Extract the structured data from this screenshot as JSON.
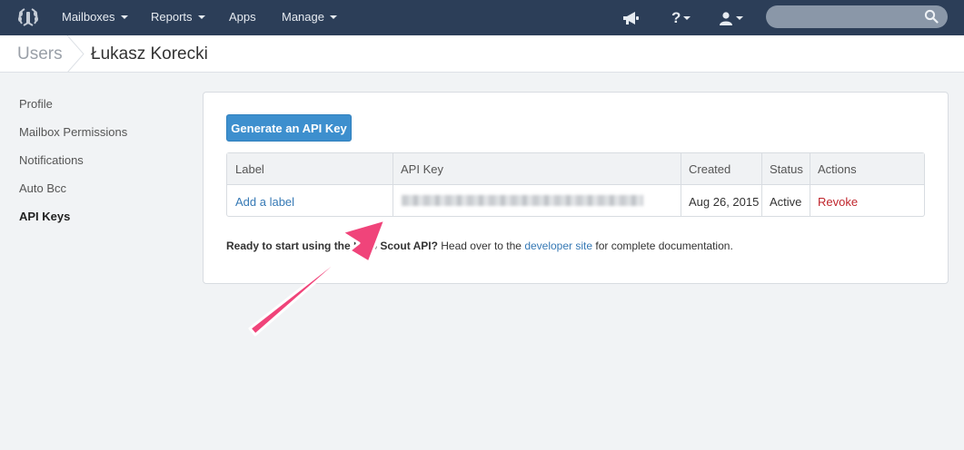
{
  "topnav": {
    "menus": [
      {
        "label": "Mailboxes",
        "has_caret": true
      },
      {
        "label": "Reports",
        "has_caret": true
      },
      {
        "label": "Apps",
        "has_caret": false
      },
      {
        "label": "Manage",
        "has_caret": true
      }
    ],
    "icons": [
      "laurel-logo-icon",
      "megaphone-icon",
      "help-icon",
      "user-icon",
      "search-icon"
    ],
    "help_glyph": "?",
    "search": {
      "placeholder": "",
      "value": ""
    }
  },
  "breadcrumb": {
    "parent": "Users",
    "current": "Łukasz Korecki"
  },
  "sidebar": {
    "items": [
      {
        "label": "Profile",
        "active": false
      },
      {
        "label": "Mailbox Permissions",
        "active": false
      },
      {
        "label": "Notifications",
        "active": false
      },
      {
        "label": "Auto Bcc",
        "active": false
      },
      {
        "label": "API Keys",
        "active": true
      }
    ]
  },
  "main": {
    "generate_button": "Generate an API Key",
    "table": {
      "headers": {
        "label": "Label",
        "api_key": "API Key",
        "created": "Created",
        "status": "Status",
        "actions": "Actions"
      },
      "rows": [
        {
          "label": "Add a label",
          "api_key": "(blurred)",
          "created": "Aug 26, 2015",
          "status": "Active",
          "action": "Revoke"
        }
      ]
    },
    "note": {
      "bold_part": "Ready to start using the Help Scout API?",
      "text_before_link": " Head over to the ",
      "link": "developer site",
      "text_after_link": " for complete documentation."
    }
  },
  "colors": {
    "topnav_bg": "#2c3e58",
    "primary_button": "#3d8fce",
    "link": "#3679b5",
    "danger": "#c0262d",
    "annotation_arrow": "#f0447a"
  }
}
